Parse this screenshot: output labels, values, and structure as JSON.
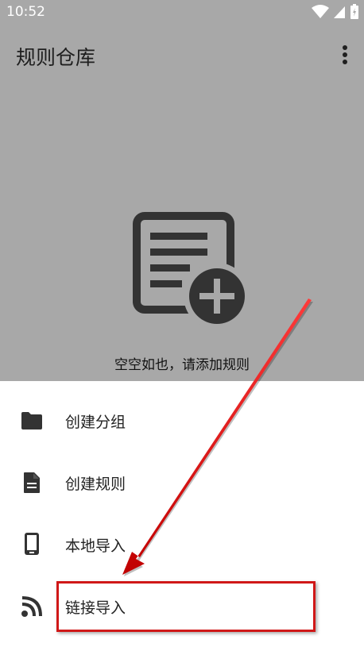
{
  "status_bar": {
    "time": "10:52",
    "icons": [
      "wifi-icon",
      "cell-signal-icon",
      "battery-icon"
    ]
  },
  "app_bar": {
    "title": "规则仓库",
    "overflow_icon": "more-vert-icon"
  },
  "empty_state": {
    "icon": "rule-add-icon",
    "message": "空空如也，请添加规则"
  },
  "bottom_sheet": {
    "items": [
      {
        "label": "创建分组",
        "icon": "folder-icon"
      },
      {
        "label": "创建规则",
        "icon": "document-icon"
      },
      {
        "label": "本地导入",
        "icon": "phone-icon"
      },
      {
        "label": "链接导入",
        "icon": "rss-icon"
      }
    ]
  },
  "annotation": {
    "highlight_color": "#d01818",
    "highlighted_item": "链接导入"
  },
  "colors": {
    "scrim": "#a8a8a8",
    "icon_dark": "#333333",
    "sheet_bg": "#ffffff"
  }
}
